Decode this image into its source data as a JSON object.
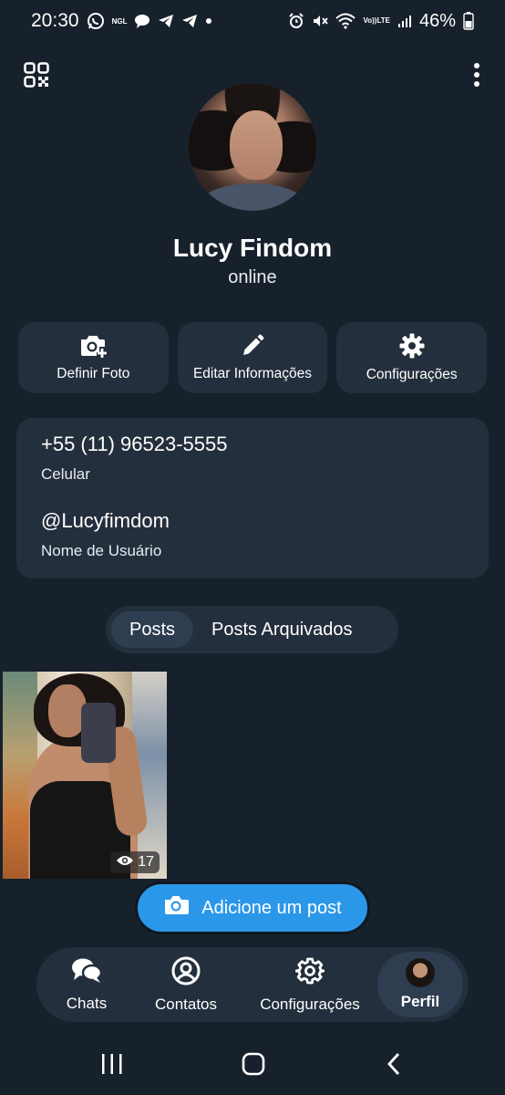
{
  "status_bar": {
    "time": "20:30",
    "app_notification_text": "NGL",
    "lte_label_top": "Vo))",
    "lte_label_bottom": "LTE",
    "battery": "46%",
    "icons": [
      "whatsapp-icon",
      "ngl-icon",
      "chat-bubble-icon",
      "telegram-icon",
      "telegram-icon",
      "dot-icon",
      "alarm-icon",
      "mute-icon",
      "wifi-icon",
      "signal-icon",
      "battery-icon"
    ]
  },
  "top_bar": {
    "icons": [
      "qr-code-icon",
      "more-vertical-icon"
    ]
  },
  "profile": {
    "name": "Lucy Findom",
    "status": "online"
  },
  "actions": [
    {
      "label": "Definir Foto",
      "icon": "camera-add-icon"
    },
    {
      "label": "Editar Informações",
      "icon": "pencil-icon"
    },
    {
      "label": "Configurações",
      "icon": "gear-icon"
    }
  ],
  "info": {
    "phone": "+55 (11) 96523-5555",
    "phone_label": "Celular",
    "username": "@Lucyfimdom",
    "username_label": "Nome de Usuário"
  },
  "tabs": [
    {
      "label": "Posts",
      "active": true
    },
    {
      "label": "Posts Arquivados",
      "active": false
    }
  ],
  "posts": [
    {
      "views": "17"
    }
  ],
  "add_post": {
    "label": "Adicione um post",
    "accent": "#2b97e9"
  },
  "bottom_nav": [
    {
      "label": "Chats",
      "icon": "chat-bubbles-icon"
    },
    {
      "label": "Contatos",
      "icon": "contact-icon"
    },
    {
      "label": "Configurações",
      "icon": "gear-icon"
    },
    {
      "label": "Perfil",
      "icon": "profile-avatar",
      "active": true
    }
  ],
  "colors": {
    "background": "#17212b",
    "card": "#242f3d",
    "active_pill": "#2f3d50"
  }
}
